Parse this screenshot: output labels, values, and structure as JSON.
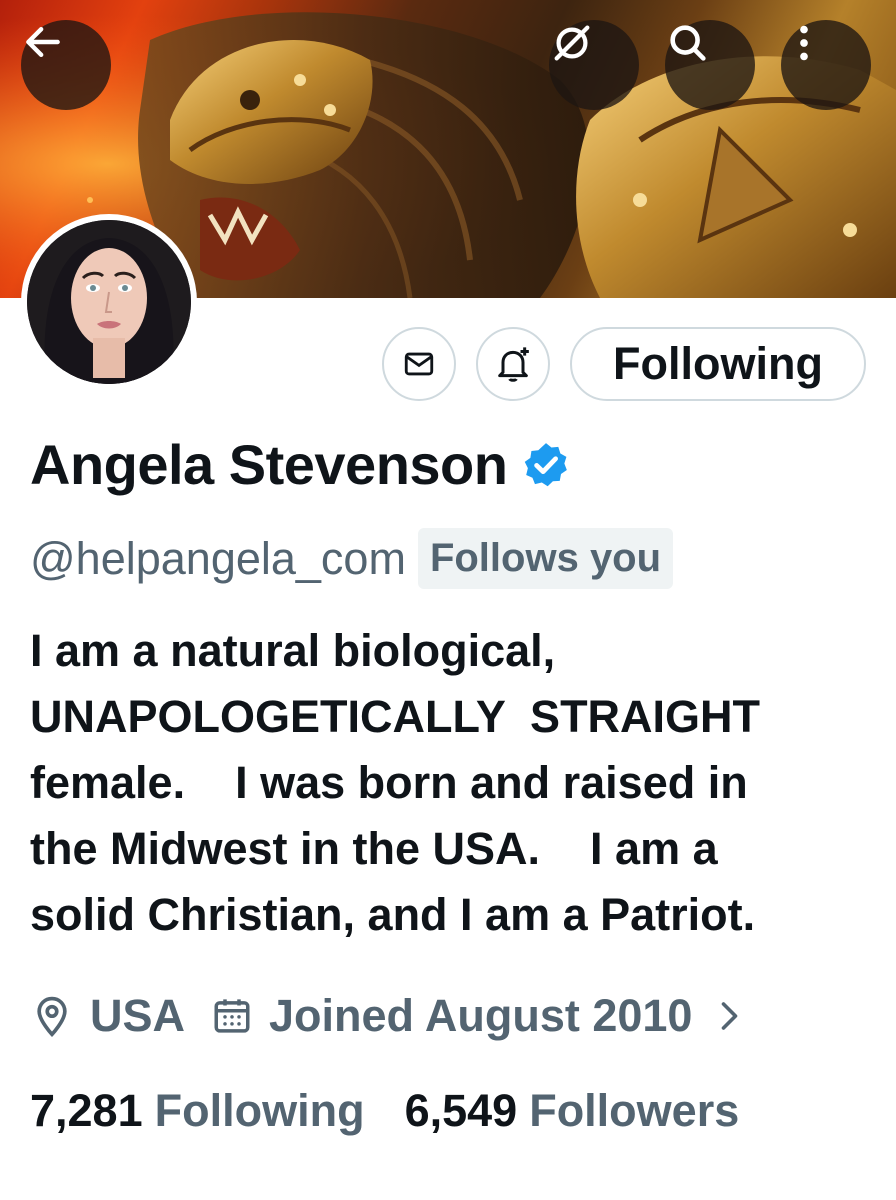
{
  "banner": {
    "image": "lion-warrior-helmet-shield-artwork",
    "back_icon": "arrow-left-icon",
    "sensitive_icon": "eye-slash-icon",
    "search_icon": "search-icon",
    "more_icon": "more-vertical-icon"
  },
  "profile": {
    "avatar": "woman-portrait-avatar",
    "display_name": "Angela Stevenson",
    "verified": true,
    "handle": "@helpangela_com",
    "follows_you_badge": "Follows you",
    "bio": "I am a natural biological,\nUNAPOLOGETICALLY  STRAIGHT\nfemale.    I was born and raised in\nthe Midwest in the USA.    I am a\nsolid Christian, and I am a Patriot.",
    "location": "USA",
    "joined": "Joined August 2010",
    "following_count": "7,281",
    "following_label": "Following",
    "followers_count": "6,549",
    "followers_label": "Followers"
  },
  "actions": {
    "message_icon": "envelope-icon",
    "notify_icon": "bell-plus-icon",
    "follow_button_label": "Following"
  },
  "colors": {
    "verified_blue": "#1d9bf0",
    "secondary_text": "#536471",
    "primary_text": "#0f1419"
  }
}
